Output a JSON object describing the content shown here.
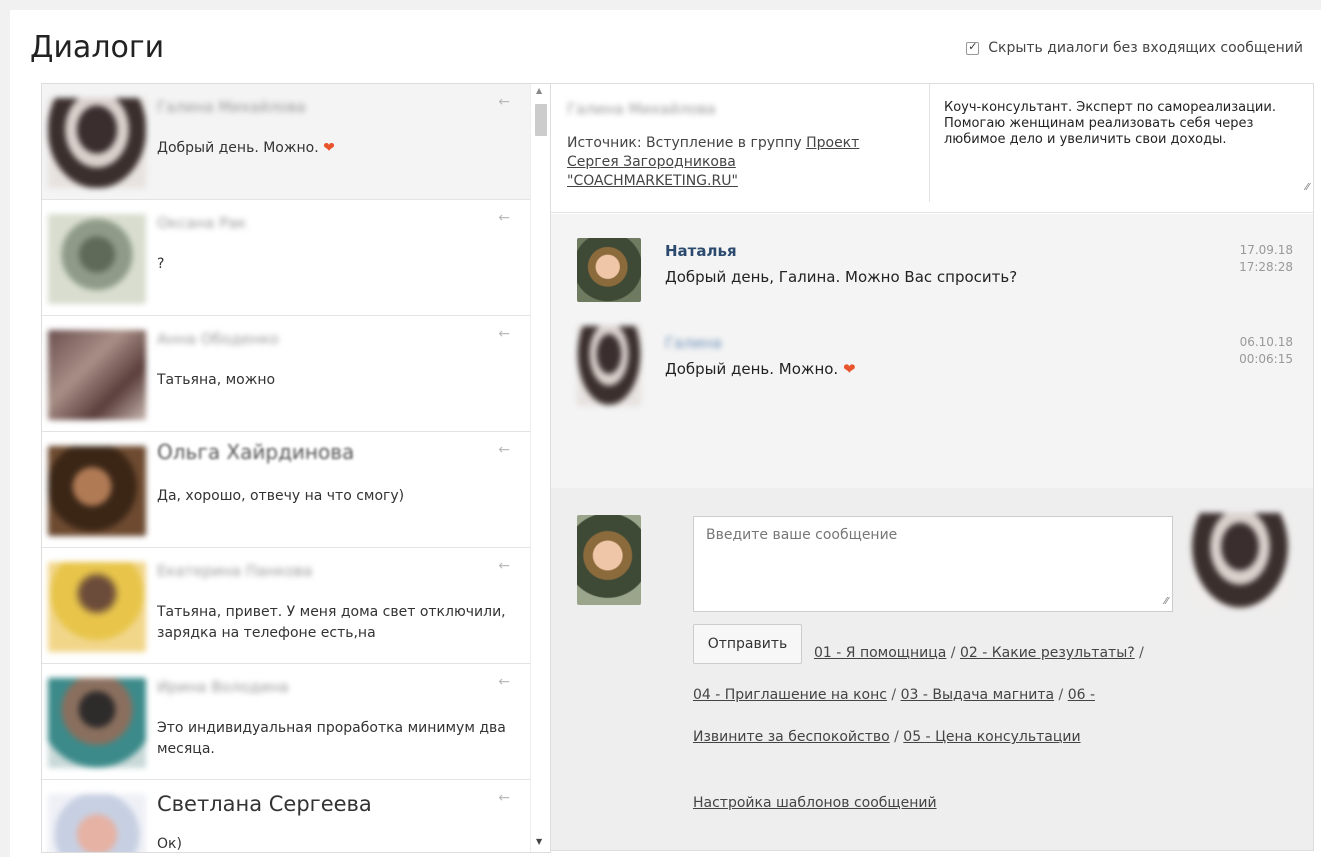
{
  "page": {
    "title": "Диалоги"
  },
  "hide_toggle": {
    "label": "Скрыть диалоги без входящих сообщений",
    "checked": true
  },
  "dialogs": [
    {
      "name": "Галина Михайлова",
      "preview": "Добрый день. Можно.",
      "emoji": "❤",
      "active": true
    },
    {
      "name": "Оксана Рак",
      "preview": "?"
    },
    {
      "name": "Анна Ободенко",
      "preview": "Татьяна, можно"
    },
    {
      "name": "Ольга Хайрдинова",
      "preview": "Да, хорошо, отвечу на что смогу)"
    },
    {
      "name": "Екатерина Панкова",
      "preview": "Татьяна, привет. У меня дома свет отключили, зарядка на телефоне есть,на"
    },
    {
      "name": "Ирина Володина",
      "preview": "Это индивидуальная проработка минимум два месяца."
    },
    {
      "name": "Светлана Сергеева",
      "preview": "Ок)"
    }
  ],
  "chat": {
    "contact_name": "Галина Михайлова",
    "source_label": "Источник: Вступление в группу",
    "source_link": "Проект Сергея Загородникова \"COACHMARKETING.RU\"",
    "bio": "Коуч-консультант. Эксперт по самореализации. Помогаю женщинам реализовать себя через любимое дело и увеличить свои доходы.",
    "messages": [
      {
        "author": "Наталья",
        "text": "Добрый день, Галина. Можно Вас спросить?",
        "date": "17.09.18",
        "time": "17:28:28"
      },
      {
        "author": "Галина",
        "text": "Добрый день. Можно.",
        "emoji": "❤",
        "date": "06.10.18",
        "time": "00:06:15"
      }
    ],
    "compose": {
      "placeholder": "Введите ваше сообщение",
      "send_label": "Отправить",
      "templates": [
        "01 - Я помощница",
        "02 - Какие результаты?",
        "04 - Приглашение на конс",
        "03 - Выдача магнита",
        "06 - Извините за беспокойство",
        "05 - Цена консультации"
      ],
      "separator": " / ",
      "settings_label": "Настройка шаблонов сообщений"
    }
  },
  "icons": {
    "reply_arrow": "←",
    "checkmark": "✓",
    "heart": "❤",
    "resize": "⁄⁄"
  },
  "colors": {
    "author_name": "#2c4a6e",
    "heart": "#e8542c",
    "active_row": "#f4f4f4"
  }
}
